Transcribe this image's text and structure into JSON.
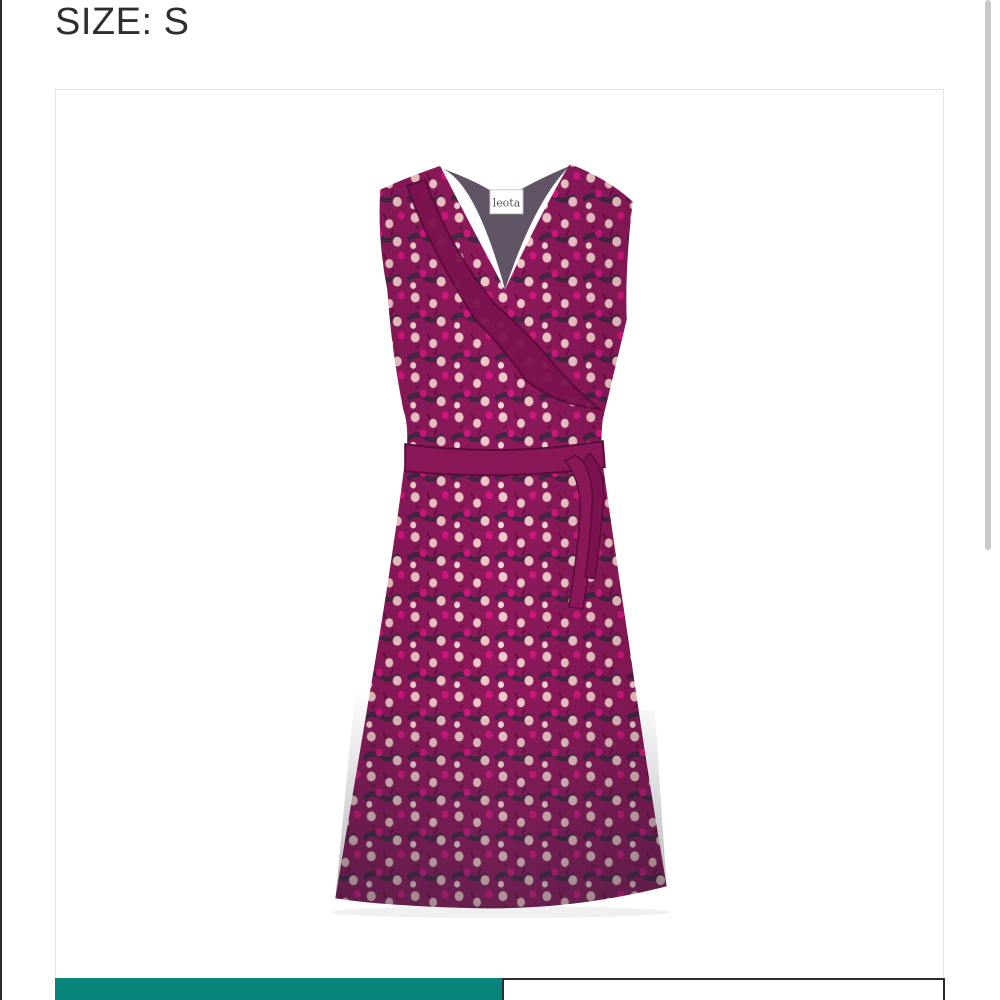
{
  "size": {
    "label": "SIZE: S"
  },
  "product_image": {
    "brand_tag": "leota",
    "colors": {
      "fabric_magenta": "#8e1a5c",
      "fabric_navy": "#2a2a3c",
      "petal_pink": "#f2c7c7",
      "bright_pink": "#d6167f"
    }
  },
  "action_bar": {
    "primary_color": "#08857b",
    "secondary_border": "#2d2d2d"
  }
}
